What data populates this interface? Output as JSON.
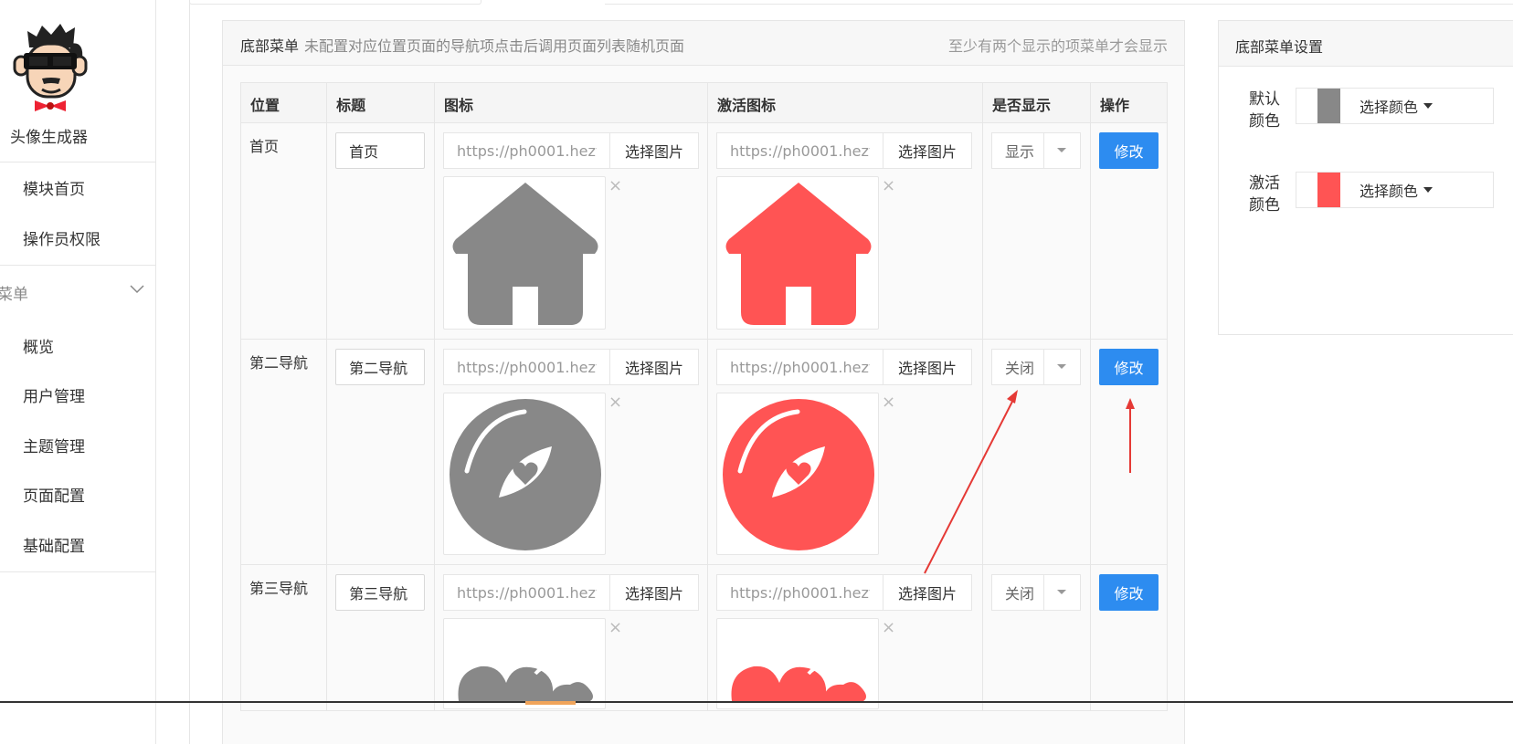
{
  "sidebar": {
    "brand": "头像生成器",
    "top_items": [
      {
        "label": "模块首页"
      },
      {
        "label": "操作员权限"
      }
    ],
    "group_label": "菜单",
    "group_items": [
      {
        "label": "概览"
      },
      {
        "label": "用户管理"
      },
      {
        "label": "主题管理"
      },
      {
        "label": "页面配置"
      },
      {
        "label": "基础配置"
      }
    ]
  },
  "panel": {
    "title": "底部菜单",
    "subtitle": "未配置对应位置页面的导航项点击后调用页面列表随机页面",
    "right_note": "至少有两个显示的项菜单才会显示",
    "columns": [
      "位置",
      "标题",
      "图标",
      "激活图标",
      "是否显示",
      "操作"
    ],
    "rows": [
      {
        "position": "首页",
        "title": "首页",
        "icon_url": "https://ph0001.hezy",
        "active_icon_url": "https://ph0001.hezy",
        "pick_label": "选择图片",
        "remove_label": "×",
        "show": "显示",
        "action": "修改",
        "icon": "home-icon"
      },
      {
        "position": "第二导航",
        "title": "第二导航",
        "icon_url": "https://ph0001.hezy",
        "active_icon_url": "https://ph0001.hezy",
        "pick_label": "选择图片",
        "remove_label": "×",
        "show": "关闭",
        "action": "修改",
        "icon": "discover-heart-icon"
      },
      {
        "position": "第三导航",
        "title": "第三导航",
        "icon_url": "https://ph0001.hezy",
        "active_icon_url": "https://ph0001.hezy",
        "pick_label": "选择图片",
        "remove_label": "×",
        "show": "关闭",
        "action": "修改",
        "icon": "hearts-icon"
      }
    ]
  },
  "settings": {
    "title": "底部菜单设置",
    "default_color_label": "默认颜色",
    "default_color": "#888888",
    "active_color_label": "激活颜色",
    "active_color": "#ff5454",
    "pick_color_label": "选择颜色"
  },
  "colors": {
    "primary_button": "#2d8cf0",
    "annotation_arrow": "#e53935"
  }
}
